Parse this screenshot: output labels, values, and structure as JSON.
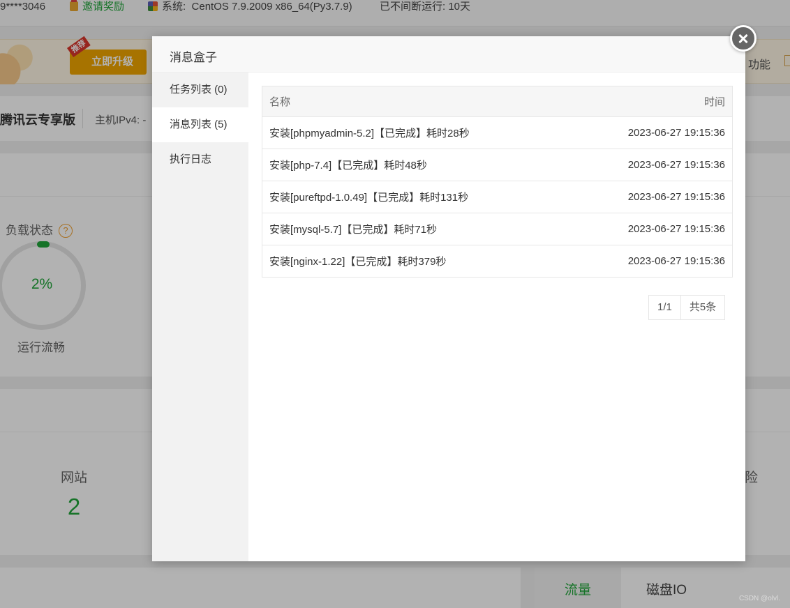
{
  "topbar": {
    "account": "9****3046",
    "invite": "邀请奖励",
    "system_label": "系统:",
    "system_value": "CentOS 7.9.2009 x86_64(Py3.7.9)",
    "uptime": "已不间断运行: 10天"
  },
  "promo": {
    "tag": "推荐",
    "upgrade": "立即升级",
    "right_text": "功能"
  },
  "host": {
    "name": "腾讯云专享版",
    "ip_label": "主机IPv4:  -"
  },
  "status": {
    "title": "负载状态",
    "help": "?",
    "value": "2%",
    "level": 0.02,
    "text": "运行流畅"
  },
  "overview": {
    "site_label": "网站",
    "site_count": "2",
    "right_label": "险"
  },
  "traffic_tabs": {
    "flow": "流量",
    "disk": "磁盘IO"
  },
  "watermark": "CSDN @olvl.",
  "modal": {
    "title": "消息盒子",
    "sidebar": [
      {
        "label": "任务列表 (0)",
        "active": false
      },
      {
        "label": "消息列表 (5)",
        "active": true
      },
      {
        "label": "执行日志",
        "active": false
      }
    ],
    "table": {
      "headers": {
        "name": "名称",
        "time": "时间"
      },
      "rows": [
        {
          "name": "安装[phpmyadmin-5.2]【已完成】耗时28秒",
          "time": "2023-06-27 19:15:36"
        },
        {
          "name": "安装[php-7.4]【已完成】耗时48秒",
          "time": "2023-06-27 19:15:36"
        },
        {
          "name": "安装[pureftpd-1.0.49]【已完成】耗时131秒",
          "time": "2023-06-27 19:15:36"
        },
        {
          "name": "安装[mysql-5.7]【已完成】耗时71秒",
          "time": "2023-06-27 19:15:36"
        },
        {
          "name": "安装[nginx-1.22]【已完成】耗时379秒",
          "time": "2023-06-27 19:15:36"
        }
      ]
    },
    "pager": {
      "page": "1/1",
      "total": "共5条"
    }
  }
}
